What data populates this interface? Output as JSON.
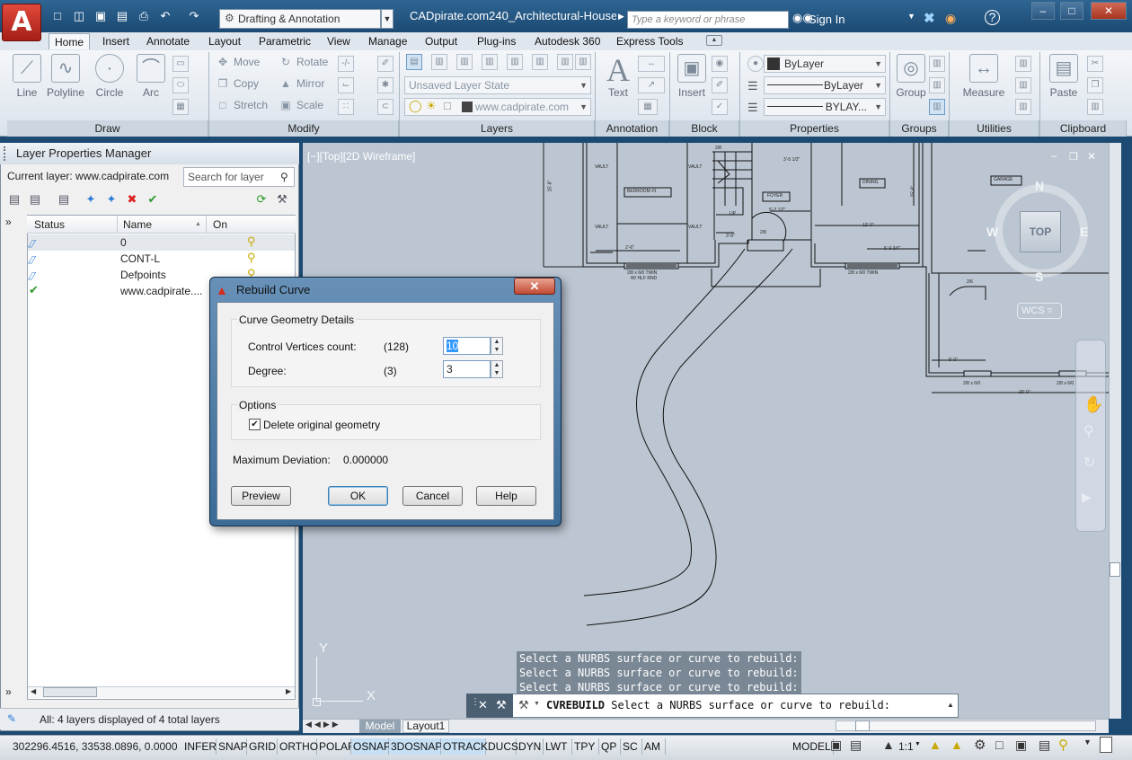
{
  "app": {
    "logo_letter": "A",
    "workspace": "Drafting & Annotation",
    "document_title": "CADpirate.com240_Architectural-House_...",
    "search_placeholder": "Type a keyword or phrase",
    "sign_in": "Sign In"
  },
  "ribbon_tabs": [
    "Home",
    "Insert",
    "Annotate",
    "Layout",
    "Parametric",
    "View",
    "Manage",
    "Output",
    "Plug-ins",
    "Autodesk 360",
    "Express Tools"
  ],
  "ribbon": {
    "draw": {
      "label": "Draw",
      "tools": [
        "Line",
        "Polyline",
        "Circle",
        "Arc"
      ]
    },
    "modify": {
      "label": "Modify",
      "tools": [
        "Move",
        "Rotate",
        "Copy",
        "Mirror",
        "Stretch",
        "Scale"
      ]
    },
    "layers": {
      "label": "Layers",
      "layer_state": "Unsaved Layer State",
      "current_layer": "www.cadpirate.com"
    },
    "annotation": {
      "label": "Annotation",
      "text_label": "Text"
    },
    "block": {
      "label": "Block",
      "insert_label": "Insert"
    },
    "properties": {
      "label": "Properties",
      "color": "ByLayer",
      "linetype": "ByLayer",
      "lineweight": "BYLAY..."
    },
    "groups": {
      "label": "Groups",
      "group_label": "Group"
    },
    "utilities": {
      "label": "Utilities",
      "measure_label": "Measure"
    },
    "clipboard": {
      "label": "Clipboard",
      "paste_label": "Paste"
    }
  },
  "layer_manager": {
    "title": "Layer Properties Manager",
    "current_layer": "Current layer: www.cadpirate.com",
    "search_placeholder": "Search for layer",
    "columns": {
      "status": "Status",
      "name": "Name",
      "on": "On"
    },
    "layers": [
      {
        "name": "0",
        "status": "layer"
      },
      {
        "name": "CONT-L",
        "status": "layer"
      },
      {
        "name": "Defpoints",
        "status": "layer"
      },
      {
        "name": "www.cadpirate....",
        "status": "current"
      }
    ],
    "status_text": "All: 4 layers displayed of 4 total layers"
  },
  "viewport": {
    "label": "[−][Top][2D Wireframe]",
    "viewcube": {
      "top": "TOP",
      "n": "N",
      "s": "S",
      "e": "E",
      "w": "W",
      "wcs": "WCS"
    },
    "ucs": {
      "x": "X",
      "y": "Y"
    },
    "room_labels": [
      "VAULT",
      "VAULT",
      "BEDROOM #1",
      "VAULT",
      "VAULT",
      "FOYER",
      "DINING",
      "GARAGE",
      "UP",
      "2/8",
      "2/8",
      "2/6",
      "2'-6\"",
      "3'-6\"",
      "5'-2 1/2\"",
      "3'-5 1/2\"",
      "12'-0\"",
      "5'-9 3/4\"",
      "5'-0\"",
      "20'-0\"",
      "15'-8\"",
      "15'-8\"",
      "2/8 x 6/0 TWIN",
      "W/ HLF RND",
      "2/8 x 6/0 TWIN",
      "2/8 x 6/0",
      "2/8 x 6/0"
    ]
  },
  "dialog": {
    "title": "Rebuild Curve",
    "geometry_group": "Curve Geometry Details",
    "cv_label": "Control Vertices count:",
    "cv_current": "(128)",
    "cv_value": "10",
    "degree_label": "Degree:",
    "degree_current": "(3)",
    "degree_value": "3",
    "options_group": "Options",
    "delete_original": "Delete original geometry",
    "delete_checked": true,
    "max_dev_label": "Maximum Deviation:",
    "max_dev_value": "0.000000",
    "buttons": {
      "preview": "Preview",
      "ok": "OK",
      "cancel": "Cancel",
      "help": "Help"
    }
  },
  "command": {
    "history": [
      "Select a NURBS surface or curve to rebuild:",
      "Select a NURBS surface or curve to rebuild:",
      "Select a NURBS surface or curve to rebuild:"
    ],
    "command_name": "CVREBUILD",
    "prompt": "Select a NURBS surface or curve to rebuild:"
  },
  "layout_tabs": [
    "Model",
    "Layout1"
  ],
  "statusbar": {
    "coords": "302296.4516, 33538.0896, 0.0000",
    "toggles": [
      {
        "label": "INFER",
        "on": false
      },
      {
        "label": "SNAP",
        "on": false
      },
      {
        "label": "GRID",
        "on": false
      },
      {
        "label": "ORTHO",
        "on": false
      },
      {
        "label": "POLAR",
        "on": false
      },
      {
        "label": "OSNAP",
        "on": true
      },
      {
        "label": "3DOSNAP",
        "on": true
      },
      {
        "label": "OTRACK",
        "on": true
      },
      {
        "label": "DUCS",
        "on": false
      },
      {
        "label": "DYN",
        "on": false
      },
      {
        "label": "LWT",
        "on": false
      },
      {
        "label": "TPY",
        "on": false
      },
      {
        "label": "QP",
        "on": false
      },
      {
        "label": "SC",
        "on": false
      },
      {
        "label": "AM",
        "on": false
      }
    ],
    "model": "MODEL",
    "scale": "1:1"
  },
  "colors": {
    "title_bar": "#1b4a73",
    "canvas": "#bcc6d2",
    "toggle_on": "#c7e0f4",
    "logo": "#c2281c"
  }
}
